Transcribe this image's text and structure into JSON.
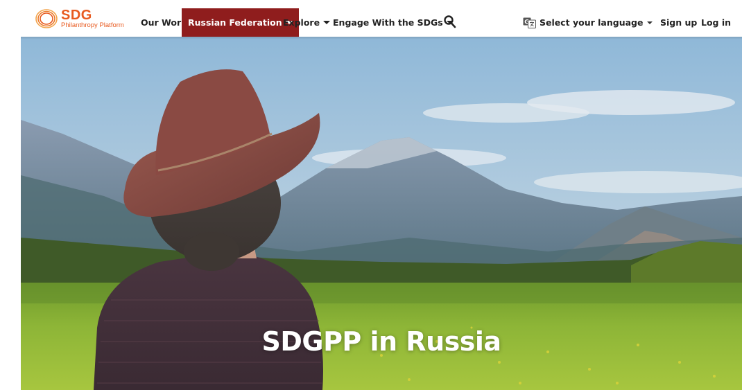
{
  "brand": {
    "name": "SDG",
    "tagline": "Philanthropy Platform",
    "color": "#e85a1f"
  },
  "nav": {
    "items": [
      {
        "label": "Our Work",
        "has_dropdown": false,
        "active": false
      },
      {
        "label": "Russian Federation",
        "has_dropdown": true,
        "active": true
      },
      {
        "label": "Explore",
        "has_dropdown": true,
        "active": false
      },
      {
        "label": "Engage With the SDGs",
        "has_dropdown": true,
        "active": false
      }
    ],
    "search_icon": "search-icon",
    "active_color": "#8f1d1d"
  },
  "language": {
    "label": "Select your language",
    "icon": "google-translate-icon"
  },
  "auth": {
    "signup": "Sign up",
    "login": "Log in"
  },
  "hero": {
    "title": "SDGPP in Russia",
    "image": "woman-in-hat-facing-mountains-meadow"
  }
}
